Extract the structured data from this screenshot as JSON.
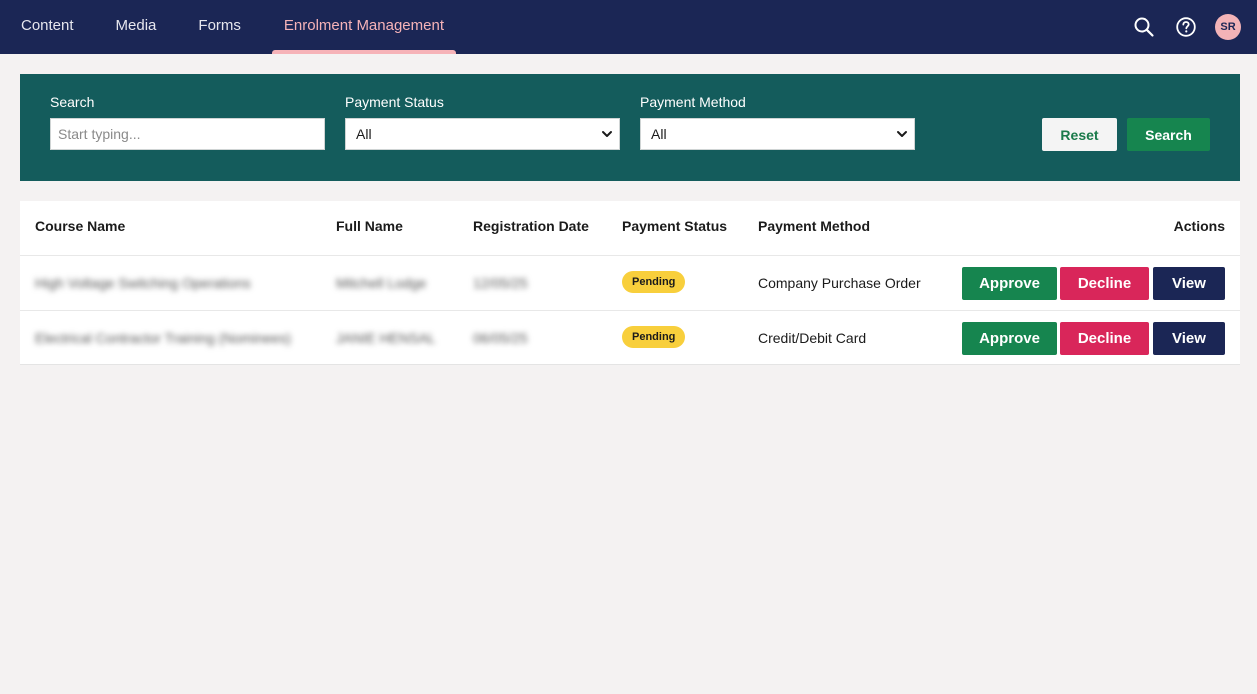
{
  "nav": {
    "items": [
      {
        "label": "Content"
      },
      {
        "label": "Media"
      },
      {
        "label": "Forms"
      },
      {
        "label": "Enrolment Management"
      }
    ],
    "avatar_initials": "SR",
    "accent": "#f6b3b8"
  },
  "filters": {
    "search_label": "Search",
    "search_placeholder": "Start typing...",
    "search_value": "",
    "payment_status_label": "Payment Status",
    "payment_status_value": "All",
    "payment_method_label": "Payment Method",
    "payment_method_value": "All",
    "reset_label": "Reset",
    "search_button_label": "Search"
  },
  "table": {
    "headers": {
      "course": "Course Name",
      "name": "Full Name",
      "date": "Registration Date",
      "status": "Payment Status",
      "method": "Payment Method",
      "actions": "Actions"
    },
    "rows": [
      {
        "course": "High Voltage Switching Operations",
        "name": "Mitchell Lodge",
        "date": "12/05/25",
        "status": "Pending",
        "method": "Company Purchase Order"
      },
      {
        "course": "Electrical Contractor Training (Nominees)",
        "name": "JANIE HENSAL",
        "date": "06/05/25",
        "status": "Pending",
        "method": "Credit/Debit Card"
      }
    ],
    "actions": {
      "approve": "Approve",
      "decline": "Decline",
      "view": "View"
    }
  },
  "colors": {
    "topbar": "#1b2655",
    "filter_panel": "#145c5c",
    "approve": "#16854f",
    "decline": "#d9265a",
    "view": "#1b2655",
    "pending_badge": "#f8cf3c"
  }
}
